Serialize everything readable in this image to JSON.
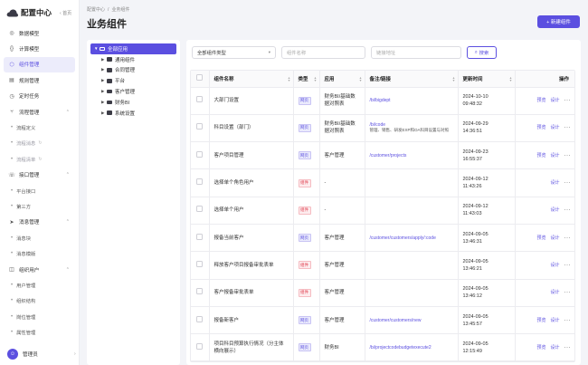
{
  "sidebar": {
    "brand": "配置中心",
    "home": "首页",
    "items": [
      {
        "label": "数据模型",
        "icon": "database-icon"
      },
      {
        "label": "计算模型",
        "icon": "braces-icon"
      },
      {
        "label": "组件管理",
        "icon": "cube-icon",
        "active": true
      },
      {
        "label": "规则管理",
        "icon": "rules-icon"
      },
      {
        "label": "定时任务",
        "icon": "clock-icon"
      }
    ],
    "groups": [
      {
        "label": "流程管理",
        "icon": "flow-icon",
        "children": [
          {
            "label": "流程定义",
            "dim": false
          },
          {
            "label": "流程消息",
            "dim": true
          },
          {
            "label": "流程清单",
            "dim": true
          }
        ]
      },
      {
        "label": "接口管理",
        "icon": "api-icon",
        "children": [
          {
            "label": "平台接口",
            "dim": false
          },
          {
            "label": "第三方",
            "dim": false
          }
        ]
      },
      {
        "label": "消息管理",
        "icon": "send-icon",
        "children": [
          {
            "label": "消息块",
            "dim": false
          },
          {
            "label": "消息模版",
            "dim": false
          }
        ]
      },
      {
        "label": "组织用户",
        "icon": "org-icon",
        "children": [
          {
            "label": "用户管理",
            "dim": false
          },
          {
            "label": "组织结构",
            "dim": false
          },
          {
            "label": "岗位管理",
            "dim": false
          },
          {
            "label": "属性管理",
            "dim": false
          }
        ]
      }
    ],
    "user": "管理员"
  },
  "breadcrumb": [
    "配置中心",
    "业务组件"
  ],
  "title": "业务组件",
  "new_button": "+ 新建组件",
  "tree": {
    "root": "全部应用",
    "children": [
      "通用组件",
      "合同管理",
      "平台",
      "客户管理",
      "财务BI",
      "系统设置"
    ]
  },
  "filters": {
    "type_select": "全部组件类型",
    "name_placeholder": "组件名称",
    "url_placeholder": "链接地址",
    "search_label": "搜索"
  },
  "table": {
    "headers": [
      "组件名称",
      "类型",
      "应用",
      "备注/链接",
      "更新时间",
      "操作"
    ],
    "rows": [
      {
        "name": "大部门设置",
        "type": "网页",
        "type_kind": "web",
        "app": "财务BI/基础数据对照表",
        "link": "/bi/bigdept",
        "desc": "",
        "date": "2024-10-10",
        "time": "09:48:32",
        "ops": [
          "预览",
          "设计"
        ]
      },
      {
        "name": "科目设置（部门）",
        "type": "网页",
        "type_kind": "web",
        "app": "财务BI/基础数据对照表",
        "link": "/bi/code",
        "desc": "管理、销售、研发EXP和OA科目设置与对照",
        "date": "2024-09-29",
        "time": "14:36:51",
        "ops": [
          "预览",
          "设计"
        ]
      },
      {
        "name": "客户项目管理",
        "type": "网页",
        "type_kind": "web",
        "app": "客户管理",
        "link": "/customer/projects",
        "desc": "",
        "date": "2024-09-23",
        "time": "16:55:37",
        "ops": [
          "预览",
          "设计"
        ]
      },
      {
        "name": "选择单个角色用户",
        "type": "组件",
        "type_kind": "comp",
        "app": "-",
        "link": "",
        "desc": "",
        "date": "2024-09-12",
        "time": "11:43:26",
        "ops": [
          "设计"
        ]
      },
      {
        "name": "选择单个用户",
        "type": "组件",
        "type_kind": "comp",
        "app": "-",
        "link": "",
        "desc": "",
        "date": "2024-09-12",
        "time": "11:43:03",
        "ops": [
          "设计"
        ]
      },
      {
        "name": "报备当前客户",
        "type": "网页",
        "type_kind": "web",
        "app": "客户管理",
        "link": "/customer/customers/apply/:code",
        "desc": "",
        "date": "2024-09-05",
        "time": "13:46:31",
        "ops": [
          "预览",
          "设计"
        ]
      },
      {
        "name": "释放客户项目报备审批表单",
        "type": "组件",
        "type_kind": "comp",
        "app": "客户管理",
        "link": "",
        "desc": "",
        "date": "2024-09-05",
        "time": "13:46:21",
        "ops": [
          "设计"
        ]
      },
      {
        "name": "客户报备审批表单",
        "type": "组件",
        "type_kind": "comp",
        "app": "客户管理",
        "link": "",
        "desc": "",
        "date": "2024-09-05",
        "time": "13:46:12",
        "ops": [
          "设计"
        ]
      },
      {
        "name": "报备新客户",
        "type": "网页",
        "type_kind": "web",
        "app": "客户管理",
        "link": "/customer/customers/new",
        "desc": "",
        "date": "2024-09-05",
        "time": "13:45:57",
        "ops": [
          "预览",
          "设计"
        ]
      },
      {
        "name": "项目科目预算执行情况（分主体横向展示）",
        "type": "网页",
        "type_kind": "web",
        "app": "财务BI",
        "link": "/bi/projectcodebudgetexecute2",
        "desc": "",
        "date": "2024-09-05",
        "time": "12:15:49",
        "ops": [
          "预览",
          "设计"
        ]
      }
    ]
  }
}
